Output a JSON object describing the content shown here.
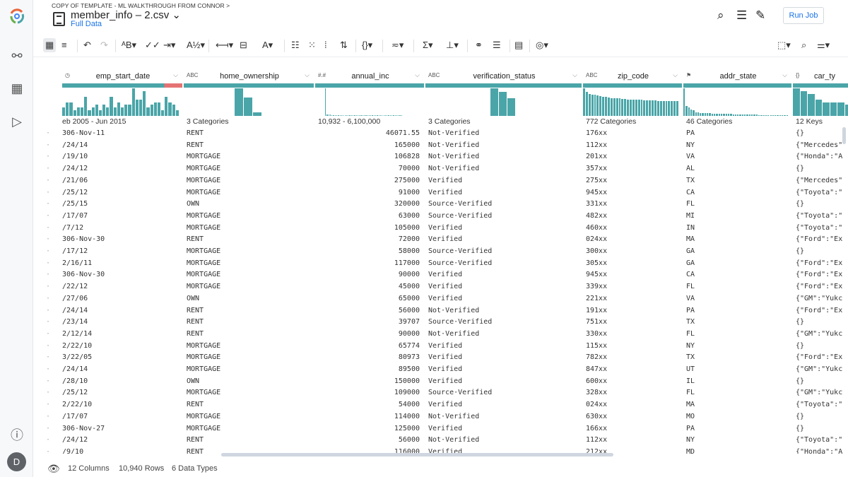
{
  "header": {
    "breadcrumb": "COPY OF TEMPLATE - ML WALKTHROUGH FROM CONNOR >",
    "title": "member_info – 2.csv ⌄",
    "subtitle": "Full Data",
    "run_job": "Run Job"
  },
  "user": {
    "initial": "D"
  },
  "colors": {
    "accent": "#1a73e8",
    "bar": "#4aa5a8",
    "missing": "#e57373"
  },
  "columns": [
    {
      "type": "◷",
      "name": "emp_start_date",
      "summary": "eb 2005 - Jun 2015",
      "hist": [
        3,
        5,
        5,
        2,
        3,
        3,
        7,
        2,
        3,
        4,
        2,
        4,
        3,
        7,
        3,
        5,
        3,
        4,
        4,
        10,
        6,
        6,
        9,
        3,
        4,
        5,
        5,
        2,
        7,
        5,
        4,
        2
      ]
    },
    {
      "type": "ABC",
      "name": "home_ownership",
      "summary": "3 Categories",
      "hist": [
        10,
        6.6,
        1.3
      ]
    },
    {
      "type": "#.#",
      "name": "annual_inc",
      "summary": "10,932 - 6,100,000",
      "hist": [
        10,
        0.4,
        0.4,
        0.4,
        0.3,
        0.3,
        0.3,
        0.3,
        0.3,
        0.3,
        0.3,
        0.3,
        0.3,
        0.3,
        0.3,
        0.3,
        0.3,
        0.3,
        0.3,
        0.3,
        0.3,
        0.3,
        0.3,
        0.3,
        0.3,
        0.3,
        0.3,
        0.3,
        0.3,
        0.3,
        0.3,
        0.3,
        0.3,
        0.3,
        0.3,
        0.3,
        0.3,
        0.3,
        0.3,
        0.3,
        0.3,
        0.3,
        0.3,
        0.3,
        0.3,
        0.3,
        0.3,
        0.3
      ]
    },
    {
      "type": "ABC",
      "name": "verification_status",
      "summary": "3 Categories",
      "hist": [
        10,
        8.7,
        6.3
      ]
    },
    {
      "type": "ABC",
      "name": "zip_code",
      "summary": "772 Categories",
      "hist": [
        10,
        8.6,
        8,
        7.8,
        7.6,
        7.4,
        7.2,
        7,
        6.8,
        6.6,
        6.5,
        6.4,
        6.3,
        6.3,
        6.2,
        6.1,
        6,
        6,
        5.9,
        5.9,
        5.8,
        5.8,
        5.7,
        5.7,
        5.6,
        5.6,
        5.6,
        5.5,
        5.5,
        5.4,
        5.4,
        5.4,
        5.3,
        5.3,
        5.3
      ]
    },
    {
      "type": "⚑",
      "name": "addr_state",
      "summary": "46 Categories",
      "hist": [
        10,
        3.5,
        3,
        2.3,
        2,
        1.3,
        1.2,
        1.1,
        1.1,
        1,
        1,
        1,
        0.9,
        0.9,
        0.9,
        0.8,
        0.8,
        0.8,
        0.7,
        0.7,
        0.7,
        0.6,
        0.6,
        0.6,
        0.5,
        0.5,
        0.5,
        0.5,
        0.4,
        0.4,
        0.4,
        0.4,
        0.3,
        0.3,
        0.3,
        0.3,
        0.3,
        0.3,
        0.3,
        0.3,
        0.3,
        0.3,
        0.3,
        0.3,
        0.3
      ]
    },
    {
      "type": "{}",
      "name": "car_ty",
      "summary": "12 Keys",
      "hist": [
        10,
        9,
        8,
        6,
        5,
        5,
        5,
        4
      ]
    }
  ],
  "rows": [
    [
      "306-Nov-11",
      "RENT",
      "46071.55",
      "Not·Verified",
      "176xx",
      "PA",
      "{}"
    ],
    [
      "/24/14",
      "RENT",
      "165000",
      "Not·Verified",
      "112xx",
      "NY",
      "{\"Mercedes\""
    ],
    [
      "/19/10",
      "MORTGAGE",
      "106828",
      "Not·Verified",
      "201xx",
      "VA",
      "{\"Honda\":\"A"
    ],
    [
      "/24/12",
      "MORTGAGE",
      "70000",
      "Not·Verified",
      "357xx",
      "AL",
      "{}"
    ],
    [
      "/21/06",
      "MORTGAGE",
      "275000",
      "Verified",
      "275xx",
      "TX",
      "{\"Mercedes\""
    ],
    [
      "/25/12",
      "MORTGAGE",
      "91000",
      "Verified",
      "945xx",
      "CA",
      "{\"Toyota\":\""
    ],
    [
      "/25/15",
      "OWN",
      "320000",
      "Source·Verified",
      "331xx",
      "FL",
      "{}"
    ],
    [
      "/17/07",
      "MORTGAGE",
      "63000",
      "Source·Verified",
      "482xx",
      "MI",
      "{\"Toyota\":\""
    ],
    [
      "/7/12",
      "MORTGAGE",
      "105000",
      "Verified",
      "460xx",
      "IN",
      "{\"Toyota\":\""
    ],
    [
      "306-Nov-30",
      "RENT",
      "72000",
      "Verified",
      "024xx",
      "MA",
      "{\"Ford\":\"Ex"
    ],
    [
      "/17/12",
      "MORTGAGE",
      "58000",
      "Source·Verified",
      "300xx",
      "GA",
      "{}"
    ],
    [
      "2/16/11",
      "MORTGAGE",
      "117000",
      "Source·Verified",
      "305xx",
      "GA",
      "{\"Ford\":\"Ex"
    ],
    [
      "306-Nov-30",
      "MORTGAGE",
      "90000",
      "Verified",
      "945xx",
      "CA",
      "{\"Ford\":\"Ex"
    ],
    [
      "/22/12",
      "MORTGAGE",
      "45000",
      "Verified",
      "339xx",
      "FL",
      "{\"Ford\":\"Ex"
    ],
    [
      "/27/06",
      "OWN",
      "65000",
      "Verified",
      "221xx",
      "VA",
      "{\"GM\":\"Yukc"
    ],
    [
      "/24/14",
      "RENT",
      "56000",
      "Not·Verified",
      "191xx",
      "PA",
      "{\"Ford\":\"Ex"
    ],
    [
      "/23/14",
      "RENT",
      "39707",
      "Source·Verified",
      "751xx",
      "TX",
      "{}"
    ],
    [
      "2/12/14",
      "RENT",
      "90000",
      "Not·Verified",
      "330xx",
      "FL",
      "{\"GM\":\"Yukc"
    ],
    [
      "2/22/10",
      "MORTGAGE",
      "65774",
      "Verified",
      "115xx",
      "NY",
      "{}"
    ],
    [
      "3/22/05",
      "MORTGAGE",
      "80973",
      "Verified",
      "782xx",
      "TX",
      "{\"Ford\":\"Ex"
    ],
    [
      "/24/14",
      "MORTGAGE",
      "89500",
      "Verified",
      "847xx",
      "UT",
      "{\"GM\":\"Yukc"
    ],
    [
      "/28/10",
      "OWN",
      "150000",
      "Verified",
      "600xx",
      "IL",
      "{}"
    ],
    [
      "/25/12",
      "MORTGAGE",
      "109000",
      "Source·Verified",
      "328xx",
      "FL",
      "{\"GM\":\"Yukc"
    ],
    [
      "2/22/10",
      "RENT",
      "54000",
      "Verified",
      "024xx",
      "MA",
      "{\"Toyota\":\""
    ],
    [
      "/17/07",
      "MORTGAGE",
      "114000",
      "Not·Verified",
      "630xx",
      "MO",
      "{}"
    ],
    [
      "306-Nov-27",
      "MORTGAGE",
      "125000",
      "Verified",
      "166xx",
      "PA",
      "{}"
    ],
    [
      "/24/12",
      "RENT",
      "56000",
      "Not·Verified",
      "112xx",
      "NY",
      "{\"Toyota\":\""
    ],
    [
      "/9/10",
      "RENT",
      "116000",
      "Verified",
      "212xx",
      "MD",
      "{\"Honda\":\"A"
    ]
  ],
  "status": {
    "columns": "12 Columns",
    "rows": "10,940 Rows",
    "types": "6 Data Types"
  }
}
